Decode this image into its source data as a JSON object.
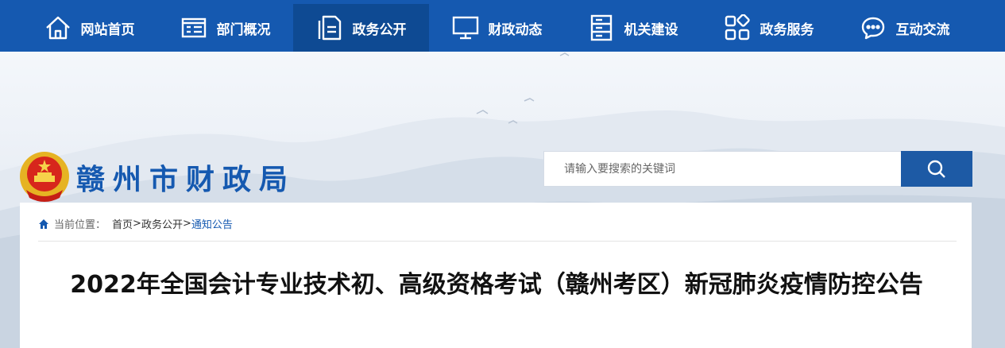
{
  "nav": {
    "items": [
      {
        "label": "网站首页",
        "icon": "home-icon",
        "active": false
      },
      {
        "label": "部门概况",
        "icon": "card-icon",
        "active": false
      },
      {
        "label": "政务公开",
        "icon": "document-icon",
        "active": true
      },
      {
        "label": "财政动态",
        "icon": "monitor-icon",
        "active": false
      },
      {
        "label": "机关建设",
        "icon": "server-icon",
        "active": false
      },
      {
        "label": "政务服务",
        "icon": "grid-icon",
        "active": false
      },
      {
        "label": "互动交流",
        "icon": "chat-icon",
        "active": false
      }
    ]
  },
  "header": {
    "site_title": "赣州市财政局",
    "emblem": "national-emblem-icon",
    "search": {
      "placeholder": "请输入要搜索的关键词",
      "value": "",
      "button_icon": "search-icon"
    }
  },
  "breadcrumb": {
    "prefix": "当前位置：",
    "items": [
      "首页",
      "政务公开",
      "通知公告"
    ],
    "separator": ">"
  },
  "article": {
    "title": "2022年全国会计专业技术初、高级资格考试（赣州考区）新冠肺炎疫情防控公告"
  },
  "colors": {
    "nav_bg": "#1559b0",
    "nav_active_bg": "#0e4a93",
    "title_blue": "#1559b0",
    "search_button": "#1d5aa5"
  }
}
